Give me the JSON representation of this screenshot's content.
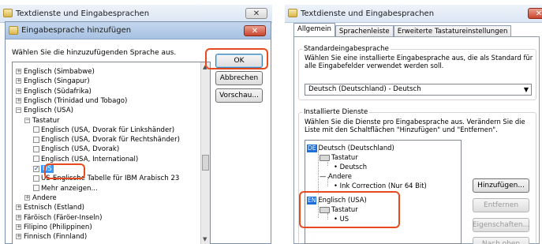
{
  "left_window": {
    "title": "Textdienste und Eingabesprachen",
    "close_label": "✕",
    "dialog": {
      "title": "Eingabesprache hinzufügen",
      "close_label": "✕",
      "prompt": "Wählen Sie die hinzuzufügenden Sprache aus.",
      "tree": [
        {
          "label": "Englisch (Simbabwe)",
          "indent": 0,
          "expander": "+"
        },
        {
          "label": "Englisch (Singapur)",
          "indent": 0,
          "expander": "+"
        },
        {
          "label": "Englisch (Südafrika)",
          "indent": 0,
          "expander": "+"
        },
        {
          "label": "Englisch (Trinidad und Tobago)",
          "indent": 0,
          "expander": "+"
        },
        {
          "label": "Englisch (USA)",
          "indent": 0,
          "expander": "−"
        },
        {
          "label": "Tastatur",
          "indent": 1,
          "expander": "−"
        },
        {
          "label": "Englisch (USA, Dvorak für Linkshänder)",
          "indent": 2,
          "checkbox": false
        },
        {
          "label": "Englisch (USA, Dvorak für Rechtshänder)",
          "indent": 2,
          "checkbox": false
        },
        {
          "label": "Englisch (USA, Dvorak)",
          "indent": 2,
          "checkbox": false
        },
        {
          "label": "Englisch (USA, International)",
          "indent": 2,
          "checkbox": false
        },
        {
          "label": "US",
          "indent": 2,
          "checkbox": true,
          "selected": true
        },
        {
          "label": "US-Englische Tabelle für IBM Arabisch 23",
          "indent": 2,
          "checkbox": false
        },
        {
          "label": "Mehr anzeigen...",
          "indent": 2,
          "checkbox": false
        },
        {
          "label": "Andere",
          "indent": 1,
          "expander": "+"
        },
        {
          "label": "Estnisch (Estland)",
          "indent": 0,
          "expander": "+"
        },
        {
          "label": "Färöisch (Färöer-Inseln)",
          "indent": 0,
          "expander": "+"
        },
        {
          "label": "Filipino (Philippinen)",
          "indent": 0,
          "expander": "+"
        },
        {
          "label": "Finnisch (Finnland)",
          "indent": 0,
          "expander": "+"
        }
      ],
      "buttons": {
        "ok": "OK",
        "cancel": "Abbrechen",
        "preview": "Vorschau..."
      }
    }
  },
  "right_window": {
    "title": "Textdienste und Eingabesprachen",
    "close_label": "✕",
    "tabs": [
      "Allgemein",
      "Sprachenleiste",
      "Erweiterte Tastatureinstellungen"
    ],
    "default_group": {
      "title": "Standardeingabesprache",
      "description": "Wählen Sie eine installierte Eingabesprache aus, die als Standard für alle Eingabefelder verwendet werden soll.",
      "selected": "Deutsch (Deutschland) - Deutsch"
    },
    "services_group": {
      "title": "Installierte Dienste",
      "description": "Wählen Sie die Dienste pro Eingabesprache aus. Verändern Sie die Liste mit den Schaltflächen \"Hinzufügen\" und \"Entfernen\".",
      "items": [
        {
          "badge": "DE",
          "label": "Deutsch (Deutschland)"
        },
        {
          "label": "Tastatur",
          "icon": "keyboard-icon"
        },
        {
          "label": "Deutsch"
        },
        {
          "label": "Andere"
        },
        {
          "label": "Ink Correction (Nur 64 Bit)"
        },
        {
          "badge": "EN",
          "label": "Englisch (USA)"
        },
        {
          "label": "Tastatur",
          "icon": "keyboard-icon"
        },
        {
          "label": "US"
        }
      ],
      "buttons": {
        "add": "Hinzufügen...",
        "remove": "Entfernen",
        "properties": "Eigenschaften...",
        "move_up": "Nach oben"
      }
    }
  },
  "colors": {
    "highlight": "#e64b1f",
    "selection": "#3399ff",
    "lang_badge": "#1c6ed8"
  }
}
